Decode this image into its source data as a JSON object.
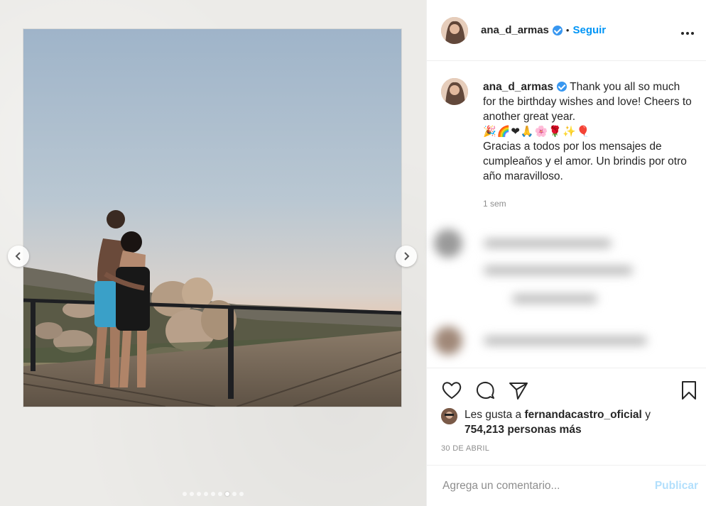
{
  "post": {
    "username": "ana_d_armas",
    "follow_label": "Seguir",
    "bullet": "•",
    "more_label": "•••"
  },
  "caption": {
    "username": "ana_d_armas",
    "text_en": "Thank you all so much for the birthday wishes and love! Cheers to another great year.",
    "emojis": "🎉🌈❤🙏🌸🌹✨🎈",
    "text_es": "Gracias a todos por los mensajes de cumpleaños y el amor. Un brindis por otro año maravilloso.",
    "time": "1 sem"
  },
  "likes": {
    "prefix": "Les gusta a",
    "liker": "fernandacastro_oficial",
    "joiner": "y",
    "others": "754,213 personas más"
  },
  "date": "30 DE ABRIL",
  "comment": {
    "placeholder": "Agrega un comentario...",
    "publish_label": "Publicar"
  },
  "carousel": {
    "total": 9,
    "active_index": 6
  },
  "colors": {
    "accent": "#0095f6",
    "verified": "#3897f0",
    "publish_disabled": "#b2dffc"
  }
}
